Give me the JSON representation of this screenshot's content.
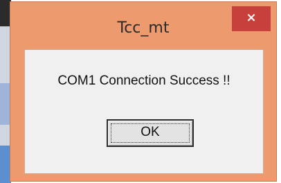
{
  "dialog": {
    "title": "Tcc_mt",
    "message": "COM1 Connection Success !!",
    "ok_label": "OK",
    "close_glyph": "×"
  },
  "colors": {
    "frame": "#ec9a6e",
    "close": "#c7403b",
    "client": "#f0f0f0"
  },
  "icons": {
    "close": "close-icon"
  }
}
